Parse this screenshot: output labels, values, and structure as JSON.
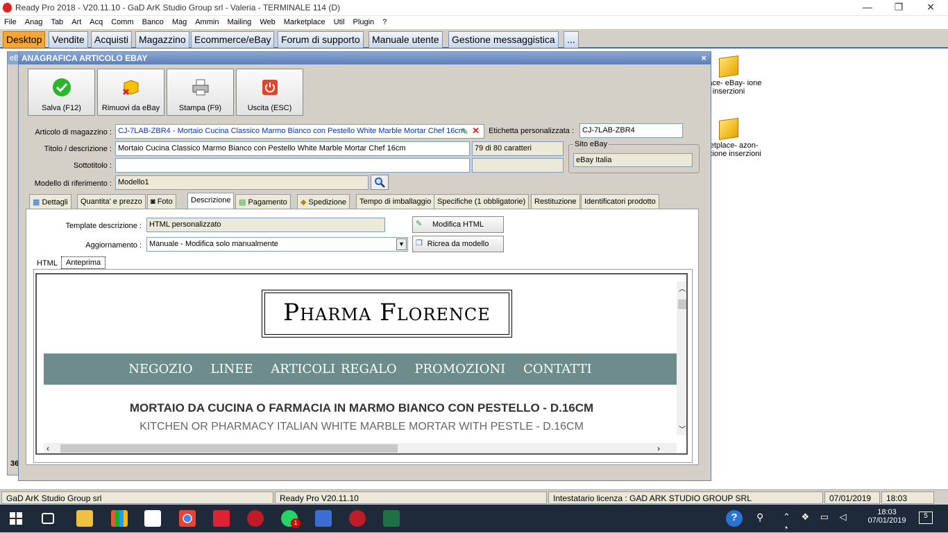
{
  "window": {
    "title": "Ready Pro 2018 - V20.11.10 - GaD ArK Studio Group srl - Valeria - TERMINALE 114 (D)",
    "minimize": "—",
    "restore": "❐",
    "close": "✕"
  },
  "menu": [
    "File",
    "Anag",
    "Tab",
    "Art",
    "Acq",
    "Comm",
    "Banco",
    "Mag",
    "Ammin",
    "Mailing",
    "Web",
    "Marketplace",
    "Util",
    "Plugin",
    "?"
  ],
  "main_tabs": [
    "Desktop",
    "Vendite",
    "Acquisti",
    "Magazzino",
    "Ecommerce/eBay",
    "Forum di supporto",
    "Manuale utente",
    "Gestione messaggistica",
    "..."
  ],
  "desktop_icons": [
    {
      "label": "etplace- eBay- ione inserzioni"
    },
    {
      "label": "arketplace- azon- Gestione inserzioni"
    }
  ],
  "bg_window_label": "eB",
  "bg_window_count": "36",
  "dialog": {
    "title": "ANAGRAFICA ARTICOLO EBAY",
    "close": "×",
    "toolbar": {
      "save": "Salva (F12)",
      "remove": "Rimuovi da eBay",
      "print": "Stampa (F9)",
      "exit": "Uscita (ESC)"
    },
    "article_label": "Articolo di magazzino :",
    "article_value": "CJ-7LAB-ZBR4 - Mortaio Cucina Classico Marmo Bianco con Pestello White Marble Mortar Chef 16cm",
    "custom_label_label": "Etichetta personalizzata :",
    "custom_label_value": "CJ-7LAB-ZBR4",
    "title_label": "Titolo / descrizione :",
    "title_value": "Mortaio Cucina Classico Marmo Bianco con Pestello White Marble Mortar Chef 16cm",
    "char_count": "79 di 80 caratteri",
    "subtitle_label": "Sottotitolo :",
    "subtitle_value": "",
    "site_group": "Sito eBay",
    "site_value": "eBay Italia",
    "model_label": "Modello di riferimento :",
    "model_value": "Modello1",
    "subtabs": [
      "Dettagli",
      "Quantita' e prezzo",
      "Foto",
      "Descrizione",
      "Pagamento",
      "Spedizione",
      "Tempo di imballaggio",
      "Specifiche (1 obbligatorie)",
      "Restituzione",
      "Identificatori prodotto"
    ],
    "template_label": "Template descrizione :",
    "template_value": "HTML personalizzato",
    "update_label": "Aggiornamento :",
    "update_value": "Manuale - Modifica solo manualmente",
    "edit_html": "Modifica HTML",
    "recreate": "Ricrea da modello",
    "inner_tabs": [
      "HTML",
      "Anteprima"
    ],
    "preview": {
      "logo": "Pharma Florence",
      "nav": [
        "NEGOZIO",
        "LINEE",
        "ARTICOLI REGALO",
        "PROMOZIONI",
        "CONTATTI"
      ],
      "heading": "MORTAIO DA CUCINA O FARMACIA IN MARMO BIANCO CON PESTELLO - D.16CM",
      "subheading": "KITCHEN OR PHARMACY ITALIAN WHITE MARBLE MORTAR WITH PESTLE - D.16CM"
    }
  },
  "status": {
    "company": "GaD ArK Studio Group srl",
    "version": "Ready Pro V20.11.10",
    "license": "Intestatario licenza : GAD ARK STUDIO GROUP SRL",
    "date": "07/01/2019",
    "time": "18:03"
  },
  "taskbar": {
    "clock_time": "18:03",
    "clock_date": "07/01/2019",
    "notif_badge": "5",
    "whatsapp_badge": "1"
  }
}
